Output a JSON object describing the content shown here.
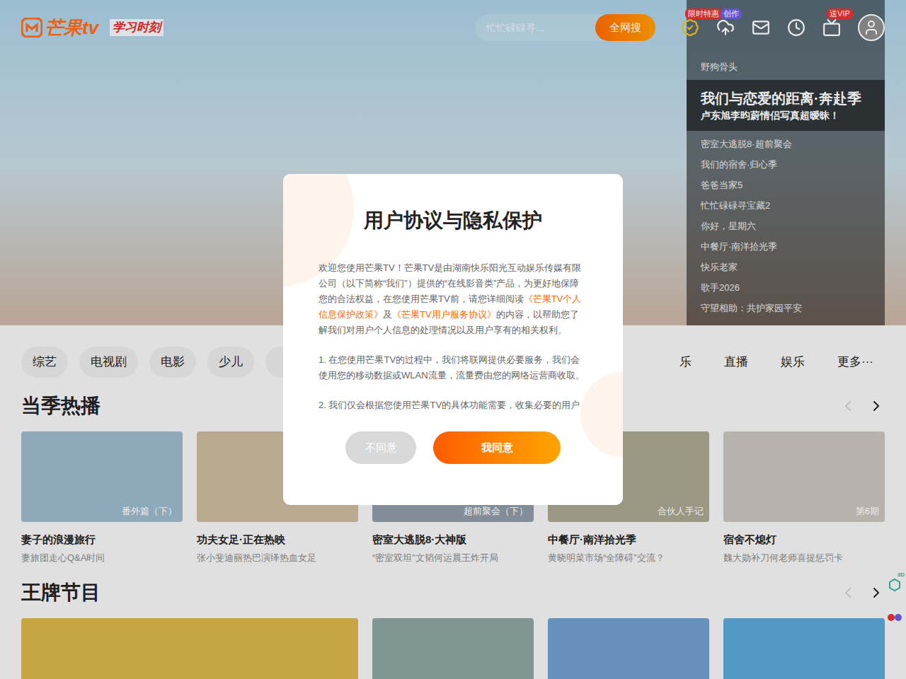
{
  "header": {
    "logo": "芒果tv",
    "logo_badge": "学习时刻",
    "search": {
      "placeholder": "忙忙碌碌寻...",
      "button": "全网搜"
    },
    "actions": [
      {
        "kind": "vip",
        "badge": "限时特惠",
        "color": "#e8322d"
      },
      {
        "kind": "upload",
        "badge": "创作",
        "color": "#6c5ce7"
      },
      {
        "kind": "mail",
        "badge": "",
        "color": "#e8322d"
      },
      {
        "kind": "history",
        "badge": "",
        "color": "#e8322d"
      },
      {
        "kind": "tv",
        "badge": "送VIP",
        "color": "#e8322d"
      }
    ]
  },
  "hero": {
    "side_list": [
      {
        "title": "野狗骨头",
        "subtitle": "",
        "selected": false
      },
      {
        "title": "我们与恋爱的距离·奔赴季",
        "subtitle": "卢东旭李昀蔚情侣写真超暧昧！",
        "selected": true
      },
      {
        "title": "密室大逃脱8·超前聚会",
        "subtitle": "",
        "selected": false
      },
      {
        "title": "我们的宿舍·归心季",
        "subtitle": "",
        "selected": false
      },
      {
        "title": "爸爸当家5",
        "subtitle": "",
        "selected": false
      },
      {
        "title": "忙忙碌碌寻宝藏2",
        "subtitle": "",
        "selected": false
      },
      {
        "title": "你好，星期六",
        "subtitle": "",
        "selected": false
      },
      {
        "title": "中餐厅·南洋拾光季",
        "subtitle": "",
        "selected": false
      },
      {
        "title": "快乐老家",
        "subtitle": "",
        "selected": false
      },
      {
        "title": "歌手2026",
        "subtitle": "",
        "selected": false
      },
      {
        "title": "守望相助：共护家园平安",
        "subtitle": "",
        "selected": false
      }
    ]
  },
  "categories_left": [
    {
      "label": "综艺"
    },
    {
      "label": "电视剧"
    },
    {
      "label": "电影"
    },
    {
      "label": "少儿"
    },
    {
      "label": ""
    }
  ],
  "categories_right": [
    {
      "label": "乐"
    },
    {
      "label": "直播"
    },
    {
      "label": "娱乐"
    },
    {
      "label": "更多···"
    }
  ],
  "sections": [
    {
      "title": "当季热播",
      "prev_disabled": true,
      "cards": [
        {
          "kind": "normal",
          "tag": "番外篇（下）",
          "title": "妻子的浪漫旅行",
          "subtitle": "妻旅团走心Q&A时间"
        },
        {
          "kind": "normal",
          "tag": "",
          "title": "功夫女足·正在热映",
          "subtitle": "张小斐迪丽热巴演绎热血女足"
        },
        {
          "kind": "normal",
          "tag": "超前聚会（下）",
          "title": "密室大逃脱8·大神版",
          "subtitle": "“密室双坦”文韬何运晨王炸开局"
        },
        {
          "kind": "normal",
          "tag": "合伙人手记",
          "title": "中餐厅·南洋拾光季",
          "subtitle": "黄晓明菜市场“全障碍”交流？"
        },
        {
          "kind": "normal",
          "tag": "第6期",
          "title": "宿舍不熄灯",
          "subtitle": "魏大勋补刀何老师喜提惩罚卡"
        }
      ]
    },
    {
      "title": "王牌节目",
      "prev_disabled": true,
      "cards": [
        {
          "kind": "wide",
          "tag": "",
          "title": "",
          "subtitle": ""
        },
        {
          "kind": "normal",
          "tag": "",
          "title": "",
          "subtitle": ""
        },
        {
          "kind": "normal",
          "tag": "",
          "title": "",
          "subtitle": ""
        },
        {
          "kind": "normal",
          "tag": "",
          "title": "",
          "subtitle": ""
        }
      ]
    }
  ],
  "floating_tools": [
    {
      "kind": "3d",
      "badge": "3D"
    },
    {
      "kind": "app",
      "badge": ""
    }
  ],
  "dialog": {
    "title": "用户协议与隐私保护",
    "paragraphs": [
      [
        {
          "text": "欢迎您使用芒果TV！芒果TV是由湖南快乐阳光互动娱乐传媒有限公司（以下简称“我们”）提供的“在线影音类”产品，为更好地保障您的合法权益，在您使用芒果TV前，请您详细阅读",
          "link": false
        },
        {
          "text": "《芒果TV个人信息保护政策》",
          "link": true
        },
        {
          "text": "及",
          "link": false
        },
        {
          "text": "《芒果TV用户服务协议》",
          "link": true
        },
        {
          "text": "的内容，以帮助您了解我们对用户个人信息的处理情况以及用户享有的相关权利。",
          "link": false
        }
      ],
      [
        {
          "text": "1. 在您使用芒果TV的过程中，我们将联网提供必要服务，我们会使用您的移动数据或WLAN流量，流量费由您的网络运营商收取。",
          "link": false
        }
      ],
      [
        {
          "text": "2. 我们仅会根据您使用芒果TV的具体功能需要，收集必要的用户",
          "link": false
        }
      ]
    ],
    "buttons": [
      {
        "label": "不同意",
        "primary": false
      },
      {
        "label": "我同意",
        "primary": true
      }
    ]
  }
}
